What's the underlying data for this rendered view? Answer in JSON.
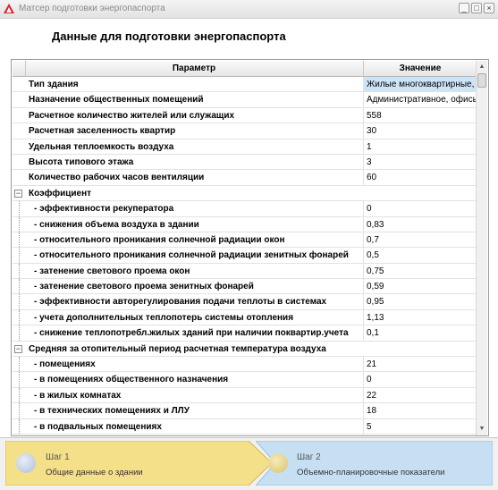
{
  "window": {
    "title": "Матсер подготовки энергопаспорта"
  },
  "heading": "Данные для подготовки энергопаспорта",
  "grid": {
    "columns": {
      "param": "Параметр",
      "value": "Значение"
    },
    "rows": [
      {
        "type": "item",
        "label": "Тип здания",
        "value": "Жилые многоквартирные,",
        "selected": true
      },
      {
        "type": "item",
        "label": "Назначение общественных помещений",
        "value": "Административное, офисы,"
      },
      {
        "type": "item",
        "label": "Расчетное количество жителей или служащих",
        "value": "558"
      },
      {
        "type": "item",
        "label": "Расчетная заселенность квартир",
        "value": "30"
      },
      {
        "type": "item",
        "label": "Удельная теплоемкость воздуха",
        "value": "1"
      },
      {
        "type": "item",
        "label": "Высота типового этажа",
        "value": "3"
      },
      {
        "type": "item",
        "label": "Количество рабочих часов вентиляции",
        "value": "60"
      },
      {
        "type": "group",
        "label": "Коэффициент",
        "expander": "−"
      },
      {
        "type": "child",
        "label": "- эффективности рекуператора",
        "value": "0"
      },
      {
        "type": "child",
        "label": "- снижения объема воздуха в здании",
        "value": "0,83"
      },
      {
        "type": "child",
        "label": "- относительного проникания солнечной радиации окон",
        "value": "0,7"
      },
      {
        "type": "child",
        "label": "- относительного проникания солнечной радиации зенитных фонарей",
        "value": "0,5"
      },
      {
        "type": "child",
        "label": "- затенение светового проема окон",
        "value": "0,75"
      },
      {
        "type": "child",
        "label": "- затенение светового проема зенитных фонарей",
        "value": "0,59"
      },
      {
        "type": "child",
        "label": "- эффективности авторегулирования подачи теплоты в системах",
        "value": "0,95"
      },
      {
        "type": "child",
        "label": "- учета дополнительных теплопотерь системы отопления",
        "value": "1,13"
      },
      {
        "type": "child",
        "label": "- снижение теплопотребл.жилых зданий при наличии поквартир.учета",
        "value": "0,1"
      },
      {
        "type": "group",
        "label": "Средняя за отопительный период расчетная температура воздуха",
        "expander": "−"
      },
      {
        "type": "child",
        "label": "- помещениях",
        "value": "21"
      },
      {
        "type": "child",
        "label": "- в помещениях общественного назначения",
        "value": "0"
      },
      {
        "type": "child",
        "label": "- в жилых комнатах",
        "value": "22"
      },
      {
        "type": "child",
        "label": "- в технических помещениях и ЛЛУ",
        "value": "18"
      },
      {
        "type": "child",
        "label": "- в подвальных помещениях",
        "value": "5"
      }
    ]
  },
  "wizard": {
    "steps": [
      {
        "title": "Шаг 1",
        "subtitle": "Общие данные о здании"
      },
      {
        "title": "Шаг 2",
        "subtitle": "Объемно-планировочные показатели"
      }
    ]
  },
  "colors": {
    "step1": "#f5e08a",
    "step2": "#c7dff3",
    "selection": "#cde4f7"
  }
}
